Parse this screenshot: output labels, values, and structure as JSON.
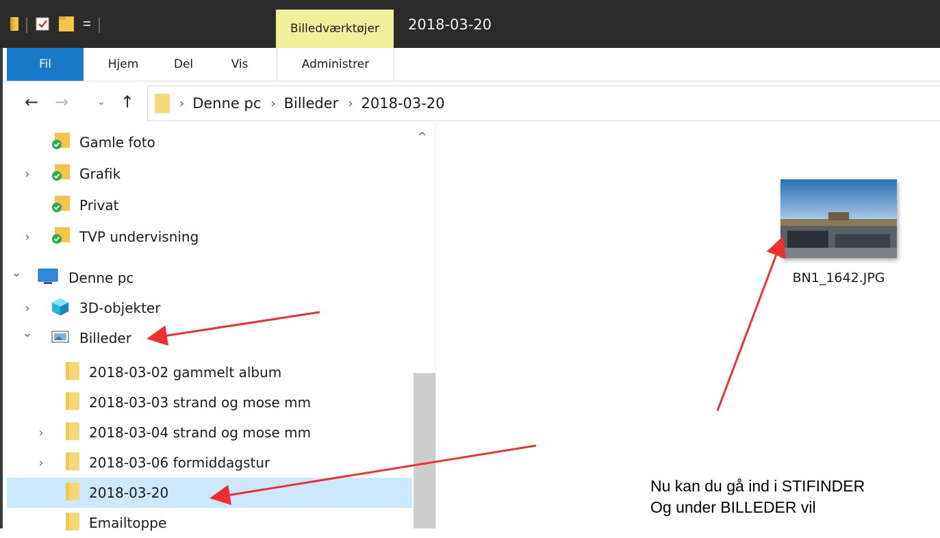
{
  "window": {
    "title": "2018-03-20",
    "context_tab": "Billedværktøjer"
  },
  "ribbon": {
    "tabs": [
      "Fil",
      "Hjem",
      "Del",
      "Vis",
      "Administrer"
    ]
  },
  "address_bar": {
    "crumbs": [
      "Denne pc",
      "Billeder",
      "2018-03-20"
    ]
  },
  "nav_pane": {
    "items": [
      {
        "label": "Gamle foto",
        "icon": "folder-synced-icon",
        "chevron": "none",
        "level": 1
      },
      {
        "label": "Grafik",
        "icon": "folder-synced-icon",
        "chevron": "collapsed",
        "level": 1
      },
      {
        "label": "Privat",
        "icon": "folder-synced-icon",
        "chevron": "none",
        "level": 1
      },
      {
        "label": "TVP undervisning",
        "icon": "folder-synced-icon",
        "chevron": "collapsed",
        "level": 1
      },
      {
        "label": "Denne pc",
        "icon": "computer-icon",
        "chevron": "expanded",
        "level": 0
      },
      {
        "label": "3D-objekter",
        "icon": "cube-icon",
        "chevron": "collapsed",
        "level": 1
      },
      {
        "label": "Billeder",
        "icon": "pictures-icon",
        "chevron": "expanded",
        "level": 1
      },
      {
        "label": "2018-03-02 gammelt album",
        "icon": "folder-icon",
        "chevron": "none",
        "level": 2
      },
      {
        "label": "2018-03-03 strand og mose mm",
        "icon": "folder-icon",
        "chevron": "none",
        "level": 2
      },
      {
        "label": "2018-03-04 strand og mose mm",
        "icon": "folder-icon",
        "chevron": "collapsed",
        "level": 2
      },
      {
        "label": "2018-03-06 formiddagstur",
        "icon": "folder-icon",
        "chevron": "collapsed",
        "level": 2
      },
      {
        "label": "2018-03-20",
        "icon": "folder-icon",
        "chevron": "none",
        "level": 2,
        "selected": true
      },
      {
        "label": "Emailtoppe",
        "icon": "folder-icon",
        "chevron": "none",
        "level": 2
      }
    ]
  },
  "content": {
    "files": [
      {
        "name": "BN1_1642.JPG",
        "icon": "image-thumbnail"
      }
    ]
  },
  "annotation": {
    "lines": [
      "Nu kan du gå ind i STIFINDER",
      "Og under BILLEDER vil"
    ]
  },
  "colors": {
    "titlebar": "#2b2b2b",
    "file_tab": "#1979ca",
    "context_tab": "#f0f09a",
    "selection": "#cce8ff",
    "folder": "#f8d775",
    "arrow": "#f03030"
  }
}
